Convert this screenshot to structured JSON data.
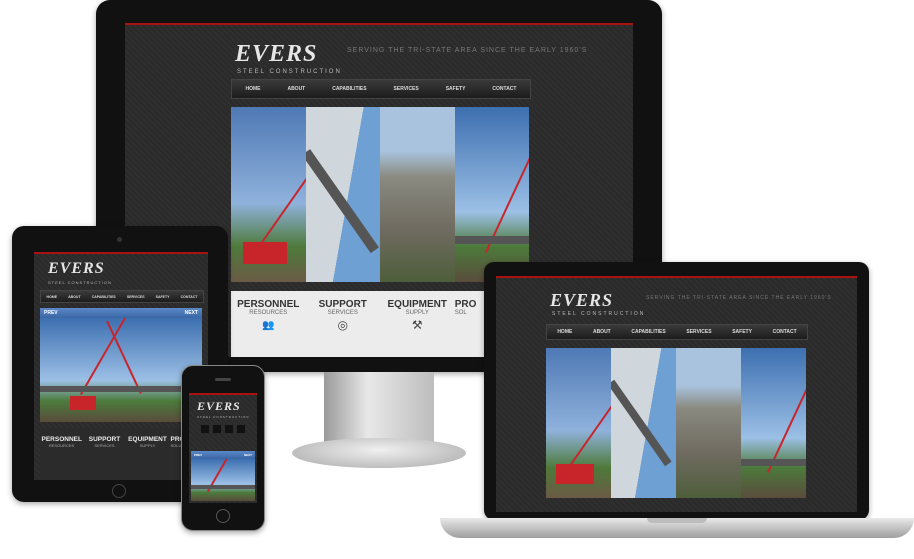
{
  "brand": {
    "logo": "EVERS",
    "logo_sub": "STEEL CONSTRUCTION",
    "tagline": "SERVING THE TRI-STATE AREA SINCE THE EARLY 1960'S"
  },
  "nav": {
    "items": [
      "HOME",
      "ABOUT",
      "CAPABILITIES",
      "SERVICES",
      "SAFETY",
      "CONTACT"
    ]
  },
  "features": [
    {
      "title": "PERSONNEL",
      "sub": "RESOURCES",
      "icon": "people-icon",
      "glyph": "👥"
    },
    {
      "title": "SUPPORT",
      "sub": "SERVICES",
      "icon": "lifebuoy-icon",
      "glyph": "◎"
    },
    {
      "title": "EQUIPMENT",
      "sub": "SUPPLY",
      "icon": "tools-icon",
      "glyph": "⚒"
    },
    {
      "title": "PRO",
      "sub": "SOL",
      "icon": "project-icon",
      "glyph": "▤"
    }
  ],
  "tablet_features": [
    {
      "title": "PERSONNEL",
      "sub": "RESOURCES"
    },
    {
      "title": "SUPPORT",
      "sub": "SERVICES"
    },
    {
      "title": "EQUIPMENT",
      "sub": "SUPPLY"
    },
    {
      "title": "PRO",
      "sub": "SOLU"
    }
  ],
  "slider": {
    "prev": "PREV",
    "next": "NEXT"
  },
  "colors": {
    "accent": "#aa1111",
    "background": "#2b2b2b",
    "nav": "#1c1c1c",
    "slider_bar": "#4a78ba"
  }
}
